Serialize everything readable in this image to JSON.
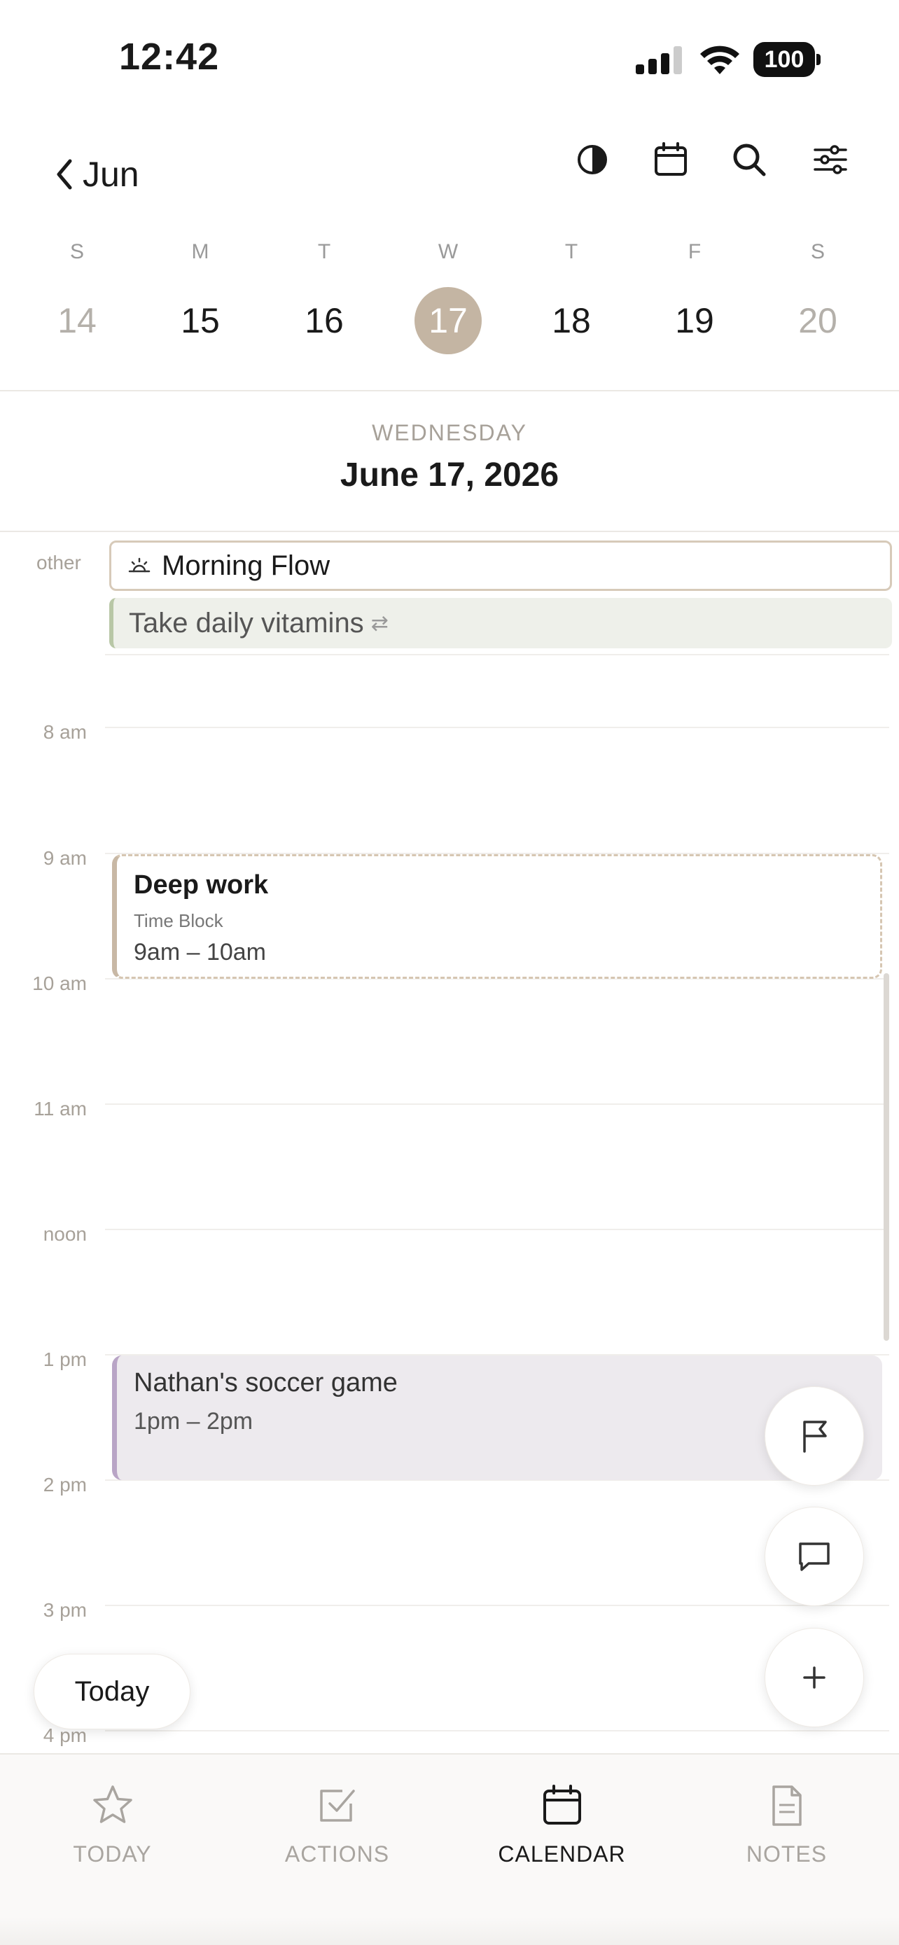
{
  "status_bar": {
    "time": "12:42",
    "battery": "100"
  },
  "header": {
    "back_label": "Jun",
    "icons": [
      "contrast-icon",
      "calendar-icon",
      "search-icon",
      "sliders-icon"
    ]
  },
  "week": {
    "days": [
      {
        "letter": "S",
        "number": "14",
        "state": "muted"
      },
      {
        "letter": "M",
        "number": "15",
        "state": "normal"
      },
      {
        "letter": "T",
        "number": "16",
        "state": "normal"
      },
      {
        "letter": "W",
        "number": "17",
        "state": "selected"
      },
      {
        "letter": "T",
        "number": "18",
        "state": "normal"
      },
      {
        "letter": "F",
        "number": "19",
        "state": "normal"
      },
      {
        "letter": "S",
        "number": "20",
        "state": "muted"
      }
    ]
  },
  "date_heading": {
    "weekday": "WEDNESDAY",
    "date": "June 17, 2026"
  },
  "all_day": {
    "label": "other",
    "items": [
      {
        "title": "Morning Flow",
        "icon": "sunrise-icon"
      },
      {
        "title": "Take daily vitamins",
        "icon": "repeat-icon"
      }
    ]
  },
  "timeline": {
    "hours": [
      "8 am",
      "9 am",
      "10 am",
      "11 am",
      "noon",
      "1 pm",
      "2 pm",
      "3 pm",
      "4 pm"
    ]
  },
  "events": {
    "deep_work": {
      "title": "Deep work",
      "subtitle": "Time Block",
      "time": "9am – 10am"
    },
    "soccer": {
      "title": "Nathan's soccer game",
      "time": "1pm – 2pm"
    }
  },
  "today_button": "Today",
  "fabs": [
    "flag-icon",
    "comment-icon",
    "plus-icon"
  ],
  "tabs": [
    {
      "label": "TODAY",
      "icon": "star-icon",
      "active": false
    },
    {
      "label": "ACTIONS",
      "icon": "checkbox-icon",
      "active": false
    },
    {
      "label": "CALENDAR",
      "icon": "calendar-icon",
      "active": true
    },
    {
      "label": "NOTES",
      "icon": "note-icon",
      "active": false
    }
  ],
  "colors": {
    "accent": "#c4b5a3",
    "deep_work_border": "#d6c6b2",
    "soccer_accent": "#b9a5c6",
    "vitamins_accent": "#b8c7a6"
  }
}
